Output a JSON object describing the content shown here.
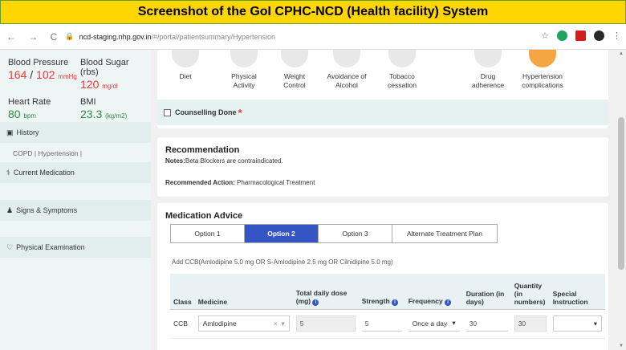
{
  "banner": {
    "title": "Screenshot of the GoI CPHC-NCD (Health facility) System"
  },
  "browser": {
    "nav": "←  →  C",
    "lock": "🔒",
    "host": "ncd-staging.nhp.gov.in",
    "path": "/#/portal/patientsummary/Hypertension",
    "star": "☆",
    "menu": "⋮"
  },
  "vitals": {
    "bp_label": "Blood Pressure",
    "bp_sys": "164",
    "bp_sep": " / ",
    "bp_dia": "102",
    "bp_unit": "mmHg",
    "sugar_label": "Blood Sugar (rbs)",
    "sugar_value": "120",
    "sugar_unit": "mg/dl",
    "hr_label": "Heart Rate",
    "hr_value": "80",
    "hr_unit": "bpm",
    "bmi_label": "BMI",
    "bmi_value": "23.3",
    "bmi_unit": "(kg/m2)"
  },
  "sidebar": {
    "history": "History",
    "history_body": "COPD | Hypertension |",
    "medication": "Current Medication",
    "signs": "Signs & Symptoms",
    "exam": "Physical Examination"
  },
  "lifestyle": {
    "items": [
      {
        "label": "Diet"
      },
      {
        "label": "Physical Activity"
      },
      {
        "label": "Weight Control"
      },
      {
        "label": "Avoidance of Alcohol"
      },
      {
        "label": "Tobacco cessation"
      },
      {
        "label": "Drug adherence"
      },
      {
        "label": "Hypertension complications"
      }
    ],
    "counselling": "Counselling Done",
    "required": "*"
  },
  "recommendation": {
    "title": "Recommendation",
    "notes_label": "Notes:",
    "notes": "Beta Blockers are contraindicated.",
    "action_label": "Recommended Action:",
    "action": " Pharmacological Treatment"
  },
  "medication": {
    "title": "Medication Advice",
    "tabs": [
      "Option 1",
      "Option 2",
      "Option 3",
      "Alternate Treatment Plan"
    ],
    "advice": "Add CCB(Amlodipine 5.0 mg OR S-Amlodipine 2.5 mg OR Cilnidipine 5.0 mg)",
    "headers": [
      "Class",
      "Medicine",
      "Total daily dose (mg)",
      "Strength",
      "Frequency",
      "Duration (in days)",
      "Quantity (in numbers)",
      "Special Instruction"
    ],
    "row": {
      "class": "CCB",
      "medicine": "Amlodipine",
      "dose": "5",
      "strength": "5",
      "frequency": "Once a day",
      "duration": "30",
      "quantity": "30",
      "instruction": ""
    }
  }
}
